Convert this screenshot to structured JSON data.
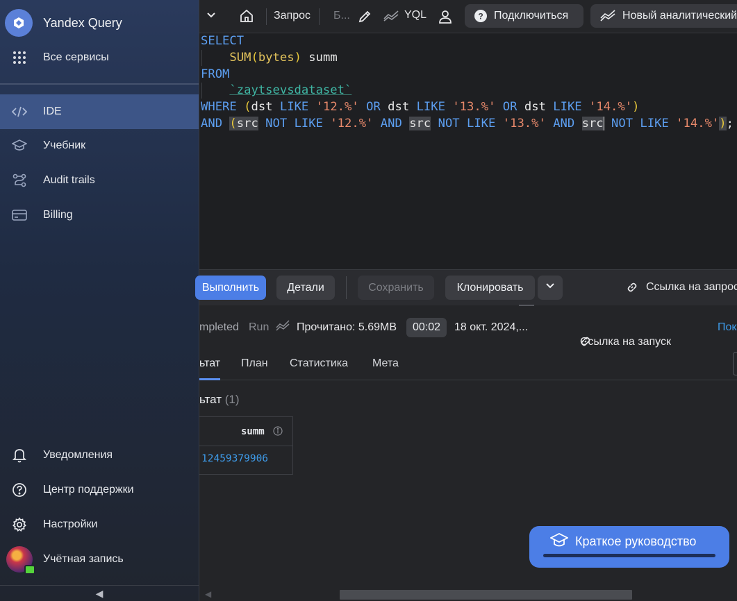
{
  "sidebar": {
    "brand": "Yandex Query",
    "all_services": "Все сервисы",
    "items": [
      {
        "label": "IDE",
        "icon": "code-icon",
        "active": true
      },
      {
        "label": "Учебник",
        "icon": "graduation-cap-icon",
        "active": false
      },
      {
        "label": "Audit trails",
        "icon": "route-icon",
        "active": false
      },
      {
        "label": "Billing",
        "icon": "credit-card-icon",
        "active": false
      }
    ],
    "bottom_items": [
      {
        "label": "Уведомления",
        "icon": "bell-icon"
      },
      {
        "label": "Центр поддержки",
        "icon": "help-circle-icon"
      },
      {
        "label": "Настройки",
        "icon": "gear-icon"
      },
      {
        "label": "Учётная запись",
        "icon": "avatar"
      }
    ],
    "collapse_glyph": "◀"
  },
  "toolbar": {
    "query_label": "Запрос",
    "query_name_truncated": "Б...",
    "syntax": "YQL",
    "connect_label": "Подключиться",
    "new_analytic_label": "Новый аналитический"
  },
  "editor": {
    "lines": [
      "SELECT",
      "SUM(bytes) summ",
      "FROM",
      "`zaytsevsdataset`",
      "WHERE (dst LIKE '12.%' OR dst LIKE '13.%' OR dst LIKE '14.%')",
      "AND (src NOT LIKE '12.%' AND src NOT LIKE '13.%' AND src NOT LIKE '14.%');"
    ]
  },
  "actions": {
    "run_label": "Выполнить",
    "details_label": "Детали",
    "save_label": "Сохранить",
    "clone_label": "Клонировать",
    "query_link_label": "Ссылка на запрос"
  },
  "status": {
    "state_truncated": "mpleted",
    "mode": "Run",
    "read_text": "Прочитано: 5.69MB",
    "duration": "00:02",
    "started_truncated": "18 окт. 2024,...",
    "run_link_label": "Ссылка на запуск",
    "more_truncated": "Пок"
  },
  "tabs": [
    {
      "label": "ьтат",
      "active": true
    },
    {
      "label": "План",
      "active": false
    },
    {
      "label": "Статистика",
      "active": false
    },
    {
      "label": "Мета",
      "active": false
    }
  ],
  "results": {
    "title_truncated": "ьтат",
    "count": "(1)",
    "columns": [
      "summ"
    ],
    "rows": [
      [
        "12459379906"
      ]
    ]
  },
  "guide": {
    "label": "Краткое руководство"
  },
  "colors": {
    "accent": "#4c7ee6",
    "sidebar_active": "#3d5587",
    "link": "#3e9be9"
  }
}
